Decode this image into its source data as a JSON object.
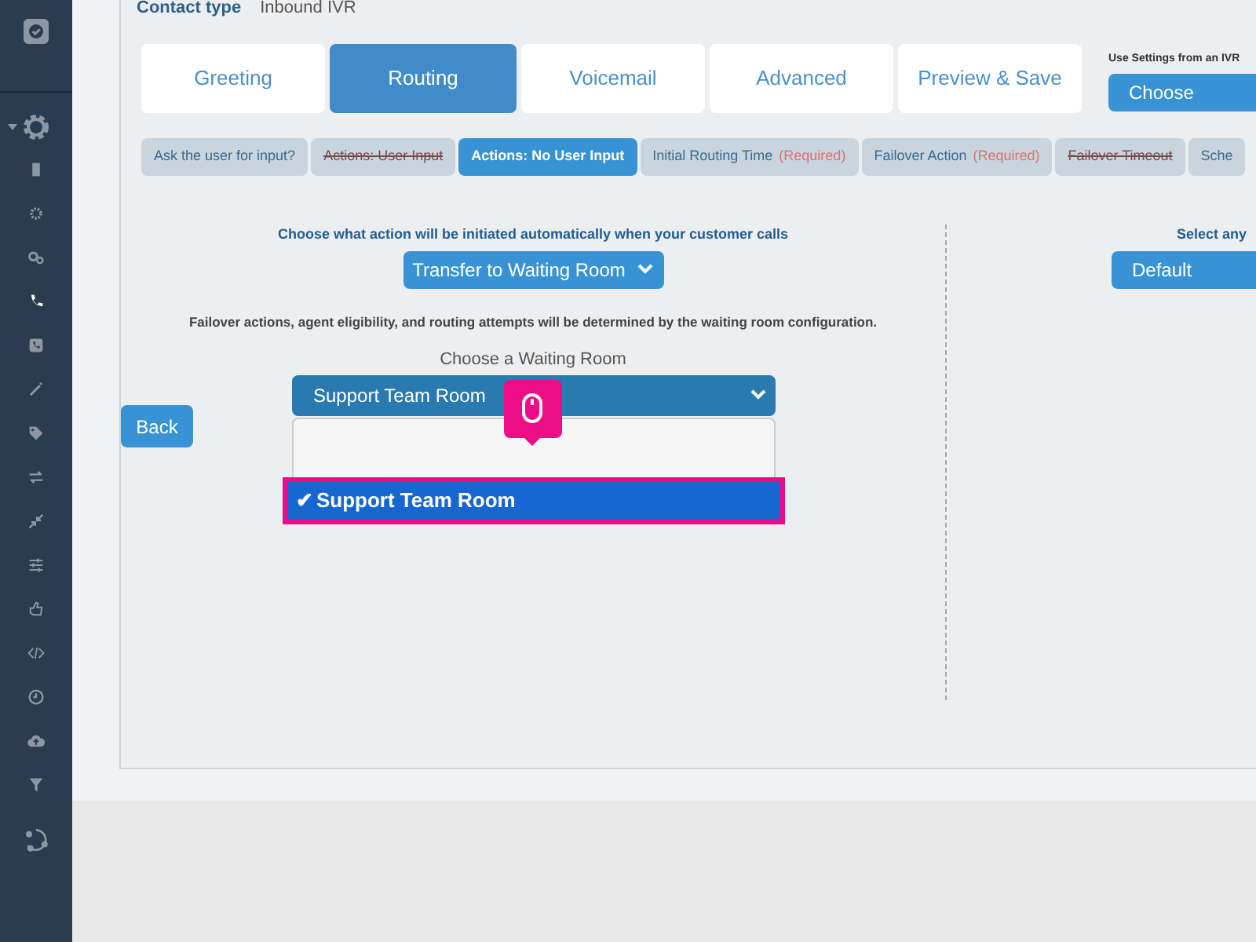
{
  "contact_type": {
    "label": "Contact type",
    "value": "Inbound IVR"
  },
  "tabs": [
    {
      "label": "Greeting",
      "selected": false
    },
    {
      "label": "Routing",
      "selected": true
    },
    {
      "label": "Voicemail",
      "selected": false
    },
    {
      "label": "Advanced",
      "selected": false
    },
    {
      "label": "Preview & Save",
      "selected": false
    }
  ],
  "ivr_settings": {
    "label": "Use Settings from an IVR",
    "button": "Choose"
  },
  "subtabs": [
    {
      "label": "Ask the user for input?",
      "selected": false,
      "disabled": false
    },
    {
      "label": "Actions: User Input",
      "selected": false,
      "disabled": true
    },
    {
      "label": "Actions: No User Input",
      "selected": true,
      "disabled": false
    },
    {
      "label": "Initial Routing Time",
      "note": "(Required)",
      "selected": false,
      "disabled": false
    },
    {
      "label": "Failover Action",
      "note": "(Required)",
      "selected": false,
      "disabled": false
    },
    {
      "label": "Failover Timeout",
      "selected": false,
      "disabled": true
    },
    {
      "label": "Sche",
      "selected": false,
      "disabled": false
    }
  ],
  "action": {
    "heading": "Choose what action will be initiated automatically when your customer calls",
    "select": "Transfer to Waiting Room"
  },
  "note": "Failover actions, agent eligibility, and routing attempts will be determined by the waiting room configuration.",
  "waiting_room": {
    "label": "Choose a Waiting Room",
    "select": "Support Team Room",
    "options": [
      {
        "check": "✔",
        "label": "Support Team Room",
        "selected": true
      }
    ]
  },
  "back_button": "Back",
  "right_panel": {
    "heading": "Select any",
    "select": "Default"
  }
}
